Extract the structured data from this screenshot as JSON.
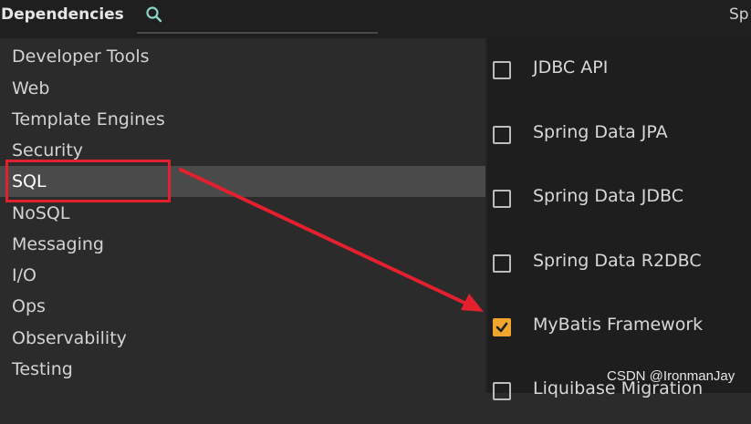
{
  "header": {
    "title": "Dependencies",
    "search_icon": "search-icon",
    "right_text": "Sp"
  },
  "categories": [
    {
      "label": "Developer Tools",
      "selected": false
    },
    {
      "label": "Web",
      "selected": false
    },
    {
      "label": "Template Engines",
      "selected": false
    },
    {
      "label": "Security",
      "selected": false
    },
    {
      "label": "SQL",
      "selected": true
    },
    {
      "label": "NoSQL",
      "selected": false
    },
    {
      "label": "Messaging",
      "selected": false
    },
    {
      "label": "I/O",
      "selected": false
    },
    {
      "label": "Ops",
      "selected": false
    },
    {
      "label": "Observability",
      "selected": false
    },
    {
      "label": "Testing",
      "selected": false
    }
  ],
  "dependencies": [
    {
      "label": "JDBC API",
      "checked": false
    },
    {
      "label": "Spring Data JPA",
      "checked": false
    },
    {
      "label": "Spring Data JDBC",
      "checked": false
    },
    {
      "label": "Spring Data R2DBC",
      "checked": false
    },
    {
      "label": "MyBatis Framework",
      "checked": true
    },
    {
      "label": "Liquibase Migration",
      "checked": false
    }
  ],
  "watermark": "CSDN @IronmanJay",
  "colors": {
    "accent_checked": "#f0a62d",
    "annotation_red": "#e3202e",
    "selected_bg": "#4a4a4a"
  }
}
